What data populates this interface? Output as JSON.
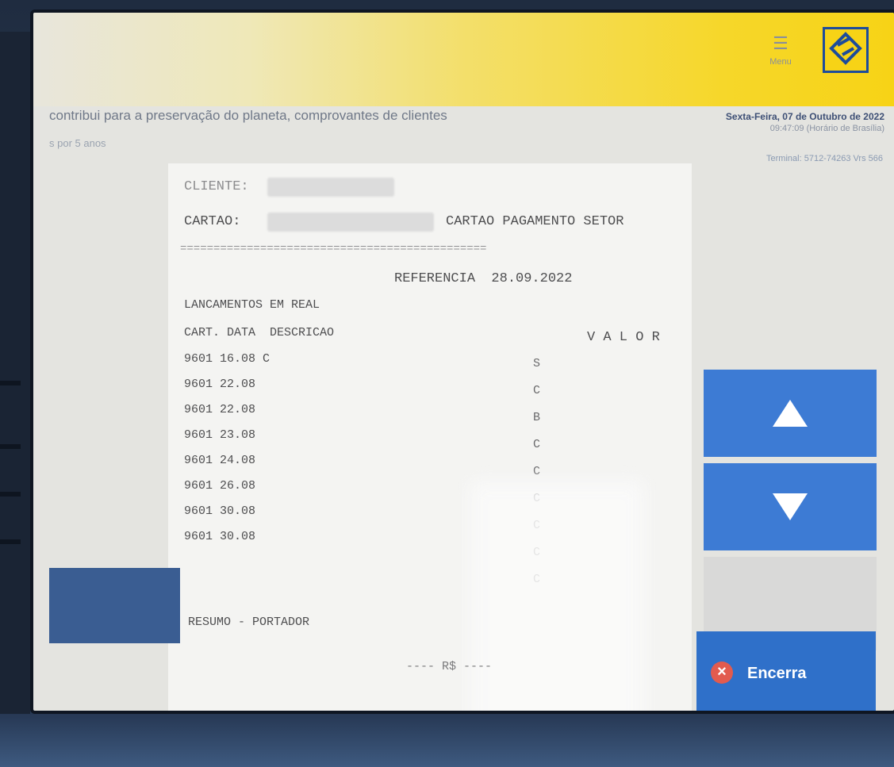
{
  "header": {
    "menu_label": "Menu",
    "menu_icon": "hamburger-icon",
    "logo_icon": "bank-logo-icon",
    "accent_color": "#f7d316",
    "brand_blue": "#1d4c9b"
  },
  "ticker": {
    "line1": "contribui para a preservação do planeta, comprovantes de clientes",
    "line2": "s por 5 anos"
  },
  "datetime": {
    "date": "Sexta-Feira, 07 de Outubro de 2022",
    "time": "09:47:09 (Horário de Brasília)"
  },
  "terminal": "Terminal: 5712-74263 Vrs 566",
  "statement": {
    "cliente_label": "CLIENTE:",
    "cartao_label": "CARTAO:",
    "card_type": "CARTAO PAGAMENTO SETOR",
    "separator": "==============================================",
    "referencia": "REFERENCIA  28.09.2022",
    "section_title": "LANCAMENTOS EM REAL",
    "columns": "CART. DATA  DESCRICAO",
    "valor_header": "V A L O R",
    "rows": [
      {
        "text": "9601 16.08 C",
        "flag": "S"
      },
      {
        "text": "9601 22.08",
        "flag": "C"
      },
      {
        "text": "9601 22.08",
        "flag": "B"
      },
      {
        "text": "9601 23.08",
        "flag": "C"
      },
      {
        "text": "9601 24.08",
        "flag": "C"
      },
      {
        "text": "9601 26.08",
        "flag": "C"
      },
      {
        "text": "9601 30.08",
        "flag": "C"
      },
      {
        "text": "9601 30.08",
        "flag": "C"
      },
      {
        "text": "",
        "flag": "C"
      }
    ],
    "resumo": "RESUMO - PORTADOR",
    "currency": "---- R$ ----"
  },
  "buttons": {
    "exit_label": "Encerra"
  }
}
